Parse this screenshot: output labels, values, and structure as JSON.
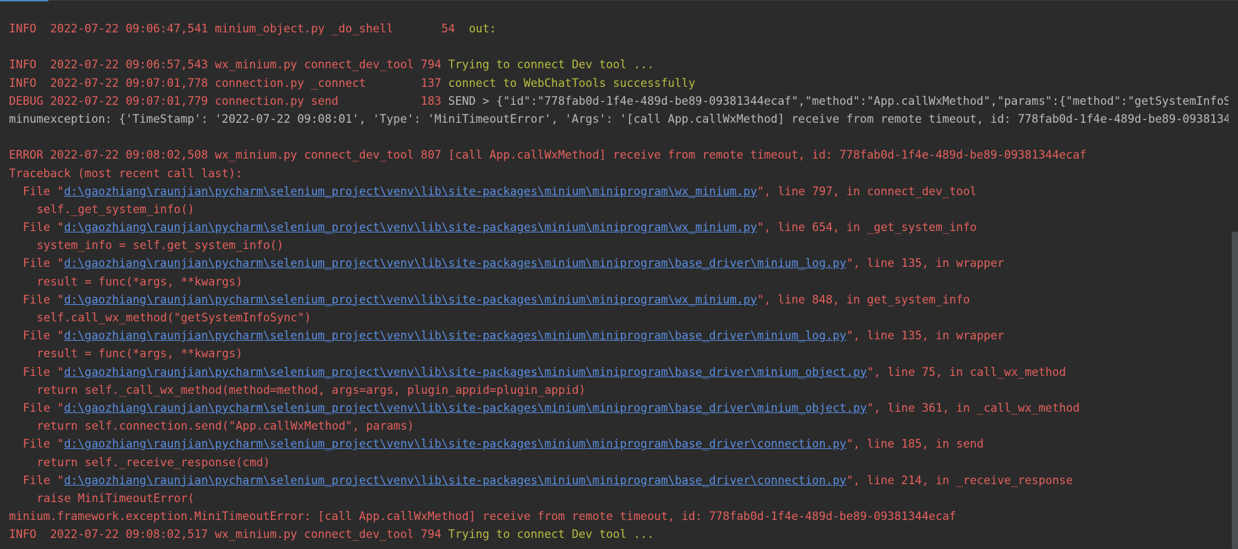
{
  "colors": {
    "background": "#2b2b2b",
    "error_red": "#e4605d",
    "message_green": "#b9bd41",
    "plain_gray": "#bbbbbb",
    "link_blue": "#5a8fe3"
  },
  "log": {
    "l1_prefix": "INFO  2022-07-22 09:06:47,541 minium_object.py _do_shell       54  ",
    "l1_msg": "out:",
    "l2_prefix": "INFO  2022-07-22 09:06:57,543 wx_minium.py connect_dev_tool 794 ",
    "l2_msg": "Trying to connect Dev tool ...",
    "l3_prefix": "INFO  2022-07-22 09:07:01,778 connection.py _connect        137 ",
    "l3_msg": "connect to WebChatTools successfully",
    "l4_prefix": "DEBUG 2022-07-22 09:07:01,779 connection.py send            183 ",
    "l4_msg": "SEND > {\"id\":\"778fab0d-1f4e-489d-be89-09381344ecaf\",\"method\":\"App.callWxMethod\",\"params\":{\"method\":\"getSystemInfoS",
    "l5": "minumexception: {'TimeStamp': '2022-07-22 09:08:01', 'Type': 'MiniTimeoutError', 'Args': '[call App.callWxMethod] receive from remote timeout, id: 778fab0d-1f4e-489d-be89-0938134",
    "l6": "ERROR 2022-07-22 09:08:02,508 wx_minium.py connect_dev_tool 807 [call App.callWxMethod] receive from remote timeout, id: 778fab0d-1f4e-489d-be89-09381344ecaf",
    "l7": "Traceback (most recent call last):",
    "file_prefix": "File \"",
    "frames": [
      {
        "path": "d:\\gaozhiang\\raunjian\\pycharm\\selenium_project\\venv\\lib\\site-packages\\minium\\miniprogram\\wx_minium.py",
        "suffix": "\", line 797, in connect_dev_tool",
        "code": "self._get_system_info()"
      },
      {
        "path": "d:\\gaozhiang\\raunjian\\pycharm\\selenium_project\\venv\\lib\\site-packages\\minium\\miniprogram\\wx_minium.py",
        "suffix": "\", line 654, in _get_system_info",
        "code": "system_info = self.get_system_info()"
      },
      {
        "path": "d:\\gaozhiang\\raunjian\\pycharm\\selenium_project\\venv\\lib\\site-packages\\minium\\miniprogram\\base_driver\\minium_log.py",
        "suffix": "\", line 135, in wrapper",
        "code": "result = func(*args, **kwargs)"
      },
      {
        "path": "d:\\gaozhiang\\raunjian\\pycharm\\selenium_project\\venv\\lib\\site-packages\\minium\\miniprogram\\wx_minium.py",
        "suffix": "\", line 848, in get_system_info",
        "code": "self.call_wx_method(\"getSystemInfoSync\")"
      },
      {
        "path": "d:\\gaozhiang\\raunjian\\pycharm\\selenium_project\\venv\\lib\\site-packages\\minium\\miniprogram\\base_driver\\minium_log.py",
        "suffix": "\", line 135, in wrapper",
        "code": "result = func(*args, **kwargs)"
      },
      {
        "path": "d:\\gaozhiang\\raunjian\\pycharm\\selenium_project\\venv\\lib\\site-packages\\minium\\miniprogram\\base_driver\\minium_object.py",
        "suffix": "\", line 75, in call_wx_method",
        "code": "return self._call_wx_method(method=method, args=args, plugin_appid=plugin_appid)"
      },
      {
        "path": "d:\\gaozhiang\\raunjian\\pycharm\\selenium_project\\venv\\lib\\site-packages\\minium\\miniprogram\\base_driver\\minium_object.py",
        "suffix": "\", line 361, in _call_wx_method",
        "code": "return self.connection.send(\"App.callWxMethod\", params)"
      },
      {
        "path": "d:\\gaozhiang\\raunjian\\pycharm\\selenium_project\\venv\\lib\\site-packages\\minium\\miniprogram\\base_driver\\connection.py",
        "suffix": "\", line 185, in send",
        "code": "return self._receive_response(cmd)"
      },
      {
        "path": "d:\\gaozhiang\\raunjian\\pycharm\\selenium_project\\venv\\lib\\site-packages\\minium\\miniprogram\\base_driver\\connection.py",
        "suffix": "\", line 214, in _receive_response",
        "code": "raise MiniTimeoutError("
      }
    ],
    "l_exc": "minium.framework.exception.MiniTimeoutError: [call App.callWxMethod] receive from remote timeout, id: 778fab0d-1f4e-489d-be89-09381344ecaf",
    "l_last_prefix": "INFO  2022-07-22 09:08:02,517 wx_minium.py connect_dev_tool 794 ",
    "l_last_msg": "Trying to connect Dev tool ..."
  }
}
